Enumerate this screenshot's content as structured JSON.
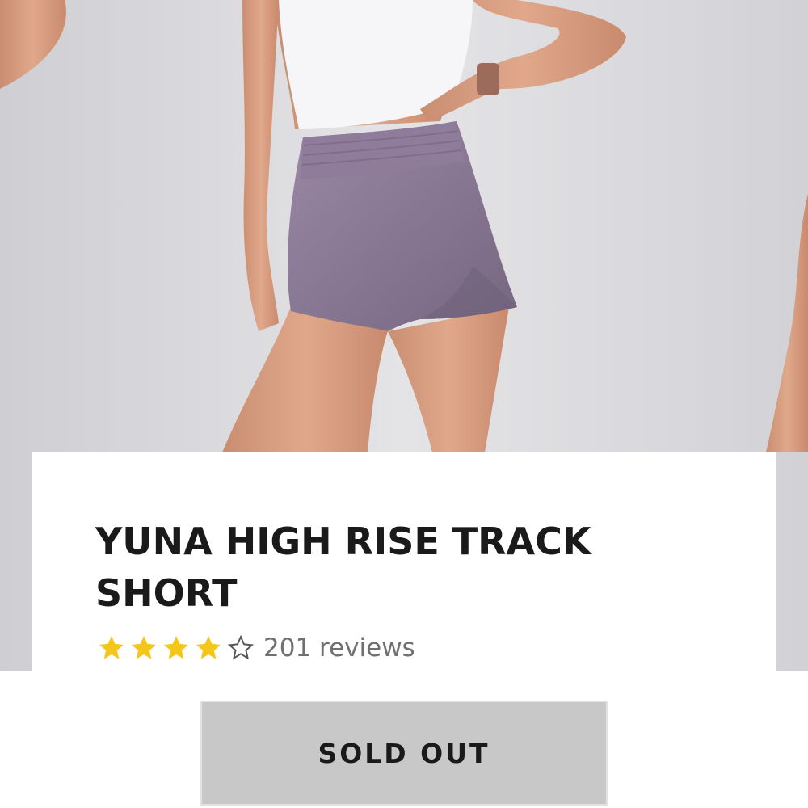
{
  "product": {
    "title": "YUNA HIGH RISE TRACK SHORT",
    "rating": 4,
    "rating_max": 5,
    "reviews_label": "201 reviews"
  },
  "actions": {
    "sold_out_label": "SOLD OUT"
  },
  "colors": {
    "star_filled": "#f5c518",
    "star_empty": "#555555",
    "shorts": "#8a7896",
    "button_bg": "#c8c8c8"
  },
  "icons": {
    "star_filled": "star-filled-icon",
    "star_empty": "star-outline-icon"
  }
}
